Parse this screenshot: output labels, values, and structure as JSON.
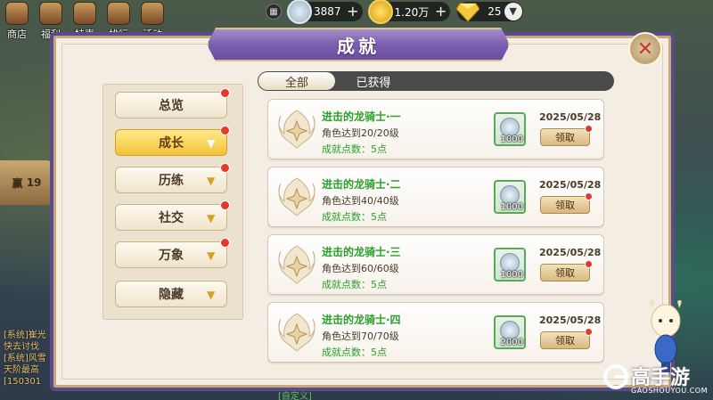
{
  "background": {
    "menu_items": [
      "商店",
      "福利",
      "特惠",
      "排行",
      "活动"
    ],
    "side_text": "赢",
    "side_num": "19",
    "chat_lines": [
      "[系统]崔光",
      "快去讨伐",
      "[系统]风雪",
      "天阶最高",
      "[150301"
    ],
    "bottom_label": "[自定义]"
  },
  "topbar": {
    "silver": "3887",
    "gold": "1.20万",
    "gem": "25"
  },
  "panel": {
    "title": "成就"
  },
  "tabs": {
    "all": "全部",
    "obtained": "已获得"
  },
  "categories": [
    {
      "label": "总览",
      "active": false,
      "has_check": false,
      "red_dot": true
    },
    {
      "label": "成长",
      "active": true,
      "has_check": true,
      "red_dot": true
    },
    {
      "label": "历练",
      "active": false,
      "has_check": true,
      "red_dot": true
    },
    {
      "label": "社交",
      "active": false,
      "has_check": true,
      "red_dot": true
    },
    {
      "label": "万象",
      "active": false,
      "has_check": true,
      "red_dot": true
    },
    {
      "label": "隐藏",
      "active": false,
      "has_check": true,
      "red_dot": false
    }
  ],
  "achievements": [
    {
      "name": "进击的龙骑士·一",
      "desc": "角色达到20/20级",
      "points": "成就点数：5点",
      "reward_qty": "1000",
      "date": "2025/05/28",
      "claim": "领取"
    },
    {
      "name": "进击的龙骑士·二",
      "desc": "角色达到40/40级",
      "points": "成就点数：5点",
      "reward_qty": "1000",
      "date": "2025/05/28",
      "claim": "领取"
    },
    {
      "name": "进击的龙骑士·三",
      "desc": "角色达到60/60级",
      "points": "成就点数：5点",
      "reward_qty": "1000",
      "date": "2025/05/28",
      "claim": "领取"
    },
    {
      "name": "进击的龙骑士·四",
      "desc": "角色达到70/70级",
      "points": "成就点数：5点",
      "reward_qty": "2000",
      "date": "2025/05/28",
      "claim": "领取"
    }
  ],
  "watermark": {
    "text": "高手游",
    "url": "GAOSHOUYOU.COM"
  },
  "colors": {
    "accent_purple": "#7a5fb0",
    "achievement_green": "#2aa02a",
    "active_gold": "#f2c23a",
    "red_dot": "#e23a2a"
  }
}
